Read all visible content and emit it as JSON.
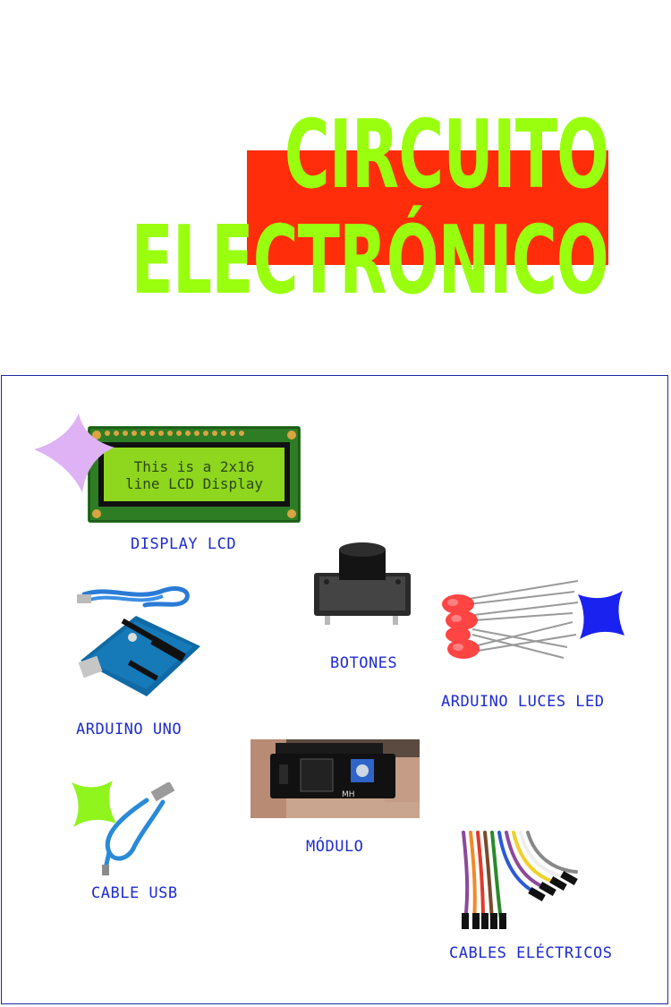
{
  "title": {
    "line1": "CIRCUITO",
    "line2": "ELECTRÓNICO"
  },
  "lcd": {
    "screen_text_1": "This is a 2x16",
    "screen_text_2": "line LCD Display"
  },
  "labels": {
    "display_lcd": "DISPLAY LCD",
    "botones": "BOTONES",
    "arduino_uno": "ARDUINO UNO",
    "arduino_luces_led": "ARDUINO LUCES LED",
    "modulo": "MÓDULO",
    "cable_usb": "CABLE USB",
    "cables_electricos": "CABLES ELÉCTRICOS"
  },
  "module_chip_text": "MH",
  "colors": {
    "title_green": "#99ff0f",
    "title_red": "#ff2d0a",
    "label_blue": "#1f2bd0",
    "frame_border": "#1a2a9e",
    "star_lilac": "#deb2f5",
    "star_blue": "#1a22f0",
    "star_green": "#8ff51c"
  }
}
